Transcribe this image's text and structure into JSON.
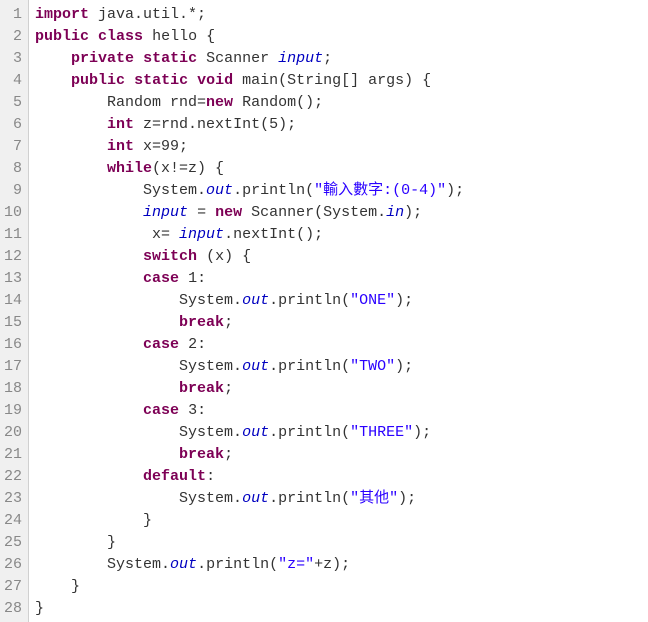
{
  "lines": [
    {
      "num": "1",
      "tokens": [
        {
          "t": "import",
          "c": "c-keyword"
        },
        {
          "t": " java.util.*;",
          "c": "c-text"
        }
      ]
    },
    {
      "num": "2",
      "tokens": [
        {
          "t": "public",
          "c": "c-keyword"
        },
        {
          "t": " ",
          "c": "c-text"
        },
        {
          "t": "class",
          "c": "c-keyword"
        },
        {
          "t": " hello {",
          "c": "c-text"
        }
      ]
    },
    {
      "num": "3",
      "tokens": [
        {
          "t": "    ",
          "c": "c-text"
        },
        {
          "t": "private",
          "c": "c-keyword"
        },
        {
          "t": " ",
          "c": "c-text"
        },
        {
          "t": "static",
          "c": "c-keyword"
        },
        {
          "t": " Scanner ",
          "c": "c-text"
        },
        {
          "t": "input",
          "c": "c-field"
        },
        {
          "t": ";",
          "c": "c-text"
        }
      ]
    },
    {
      "num": "4",
      "tokens": [
        {
          "t": "    ",
          "c": "c-text"
        },
        {
          "t": "public",
          "c": "c-keyword"
        },
        {
          "t": " ",
          "c": "c-text"
        },
        {
          "t": "static",
          "c": "c-keyword"
        },
        {
          "t": " ",
          "c": "c-text"
        },
        {
          "t": "void",
          "c": "c-keyword"
        },
        {
          "t": " main(String[] args) {",
          "c": "c-text"
        }
      ]
    },
    {
      "num": "5",
      "tokens": [
        {
          "t": "        Random rnd=",
          "c": "c-text"
        },
        {
          "t": "new",
          "c": "c-keyword"
        },
        {
          "t": " Random();",
          "c": "c-text"
        }
      ]
    },
    {
      "num": "6",
      "tokens": [
        {
          "t": "        ",
          "c": "c-text"
        },
        {
          "t": "int",
          "c": "c-keyword"
        },
        {
          "t": " z=rnd.nextInt(5);",
          "c": "c-text"
        }
      ]
    },
    {
      "num": "7",
      "tokens": [
        {
          "t": "        ",
          "c": "c-text"
        },
        {
          "t": "int",
          "c": "c-keyword"
        },
        {
          "t": " x=99;",
          "c": "c-text"
        }
      ]
    },
    {
      "num": "8",
      "tokens": [
        {
          "t": "        ",
          "c": "c-text"
        },
        {
          "t": "while",
          "c": "c-keyword"
        },
        {
          "t": "(x!=z) {",
          "c": "c-text"
        }
      ]
    },
    {
      "num": "9",
      "tokens": [
        {
          "t": "            System.",
          "c": "c-text"
        },
        {
          "t": "out",
          "c": "c-staticfield"
        },
        {
          "t": ".println(",
          "c": "c-text"
        },
        {
          "t": "\"輸入數字:(0-4)\"",
          "c": "c-string"
        },
        {
          "t": ");",
          "c": "c-text"
        }
      ]
    },
    {
      "num": "10",
      "tokens": [
        {
          "t": "            ",
          "c": "c-text"
        },
        {
          "t": "input",
          "c": "c-field"
        },
        {
          "t": " = ",
          "c": "c-text"
        },
        {
          "t": "new",
          "c": "c-keyword"
        },
        {
          "t": " Scanner(System.",
          "c": "c-text"
        },
        {
          "t": "in",
          "c": "c-staticfield"
        },
        {
          "t": ");",
          "c": "c-text"
        }
      ]
    },
    {
      "num": "11",
      "tokens": [
        {
          "t": "             x= ",
          "c": "c-text"
        },
        {
          "t": "input",
          "c": "c-field"
        },
        {
          "t": ".nextInt();",
          "c": "c-text"
        }
      ]
    },
    {
      "num": "12",
      "tokens": [
        {
          "t": "            ",
          "c": "c-text"
        },
        {
          "t": "switch",
          "c": "c-keyword"
        },
        {
          "t": " (x) {",
          "c": "c-text"
        }
      ]
    },
    {
      "num": "13",
      "tokens": [
        {
          "t": "            ",
          "c": "c-text"
        },
        {
          "t": "case",
          "c": "c-keyword"
        },
        {
          "t": " 1:",
          "c": "c-text"
        }
      ]
    },
    {
      "num": "14",
      "tokens": [
        {
          "t": "                System.",
          "c": "c-text"
        },
        {
          "t": "out",
          "c": "c-staticfield"
        },
        {
          "t": ".println(",
          "c": "c-text"
        },
        {
          "t": "\"ONE\"",
          "c": "c-string"
        },
        {
          "t": ");",
          "c": "c-text"
        }
      ]
    },
    {
      "num": "15",
      "tokens": [
        {
          "t": "                ",
          "c": "c-text"
        },
        {
          "t": "break",
          "c": "c-keyword"
        },
        {
          "t": ";",
          "c": "c-text"
        }
      ]
    },
    {
      "num": "16",
      "tokens": [
        {
          "t": "            ",
          "c": "c-text"
        },
        {
          "t": "case",
          "c": "c-keyword"
        },
        {
          "t": " 2:",
          "c": "c-text"
        }
      ]
    },
    {
      "num": "17",
      "tokens": [
        {
          "t": "                System.",
          "c": "c-text"
        },
        {
          "t": "out",
          "c": "c-staticfield"
        },
        {
          "t": ".println(",
          "c": "c-text"
        },
        {
          "t": "\"TWO\"",
          "c": "c-string"
        },
        {
          "t": ");",
          "c": "c-text"
        }
      ]
    },
    {
      "num": "18",
      "tokens": [
        {
          "t": "                ",
          "c": "c-text"
        },
        {
          "t": "break",
          "c": "c-keyword"
        },
        {
          "t": ";",
          "c": "c-text"
        }
      ]
    },
    {
      "num": "19",
      "tokens": [
        {
          "t": "            ",
          "c": "c-text"
        },
        {
          "t": "case",
          "c": "c-keyword"
        },
        {
          "t": " 3:",
          "c": "c-text"
        }
      ]
    },
    {
      "num": "20",
      "tokens": [
        {
          "t": "                System.",
          "c": "c-text"
        },
        {
          "t": "out",
          "c": "c-staticfield"
        },
        {
          "t": ".println(",
          "c": "c-text"
        },
        {
          "t": "\"THREE\"",
          "c": "c-string"
        },
        {
          "t": ");",
          "c": "c-text"
        }
      ]
    },
    {
      "num": "21",
      "tokens": [
        {
          "t": "                ",
          "c": "c-text"
        },
        {
          "t": "break",
          "c": "c-keyword"
        },
        {
          "t": ";",
          "c": "c-text"
        }
      ]
    },
    {
      "num": "22",
      "tokens": [
        {
          "t": "            ",
          "c": "c-text"
        },
        {
          "t": "default",
          "c": "c-keyword"
        },
        {
          "t": ":",
          "c": "c-text"
        }
      ]
    },
    {
      "num": "23",
      "tokens": [
        {
          "t": "                System.",
          "c": "c-text"
        },
        {
          "t": "out",
          "c": "c-staticfield"
        },
        {
          "t": ".println(",
          "c": "c-text"
        },
        {
          "t": "\"其他\"",
          "c": "c-string"
        },
        {
          "t": ");",
          "c": "c-text"
        }
      ]
    },
    {
      "num": "24",
      "tokens": [
        {
          "t": "            }",
          "c": "c-text"
        }
      ]
    },
    {
      "num": "25",
      "tokens": [
        {
          "t": "        }",
          "c": "c-text"
        }
      ]
    },
    {
      "num": "26",
      "tokens": [
        {
          "t": "        System.",
          "c": "c-text"
        },
        {
          "t": "out",
          "c": "c-staticfield"
        },
        {
          "t": ".println(",
          "c": "c-text"
        },
        {
          "t": "\"z=\"",
          "c": "c-string"
        },
        {
          "t": "+z);",
          "c": "c-text"
        }
      ]
    },
    {
      "num": "27",
      "tokens": [
        {
          "t": "    }",
          "c": "c-text"
        }
      ]
    },
    {
      "num": "28",
      "tokens": [
        {
          "t": "}",
          "c": "c-text"
        }
      ]
    }
  ]
}
